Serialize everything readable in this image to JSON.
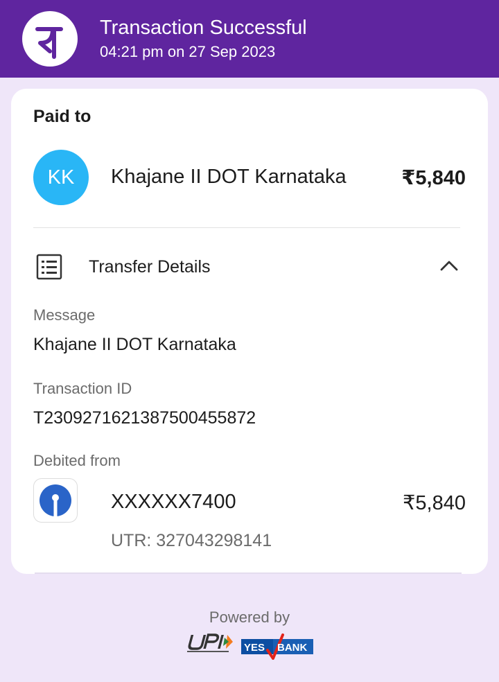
{
  "header": {
    "title": "Transaction Successful",
    "subtitle": "04:21 pm on 27 Sep 2023",
    "logo_icon": "phonepe-logo-icon",
    "bg_color": "#5f259f"
  },
  "payment": {
    "heading": "Paid to",
    "avatar_initials": "KK",
    "avatar_color": "#29b6f6",
    "payee_name": "Khajane II DOT Karnataka",
    "amount": "₹5,840"
  },
  "transfer_details": {
    "title": "Transfer Details",
    "icon": "receipt-list-icon",
    "toggle_icon": "chevron-up-icon",
    "message_label": "Message",
    "message_value": "Khajane II DOT Karnataka",
    "transaction_id_label": "Transaction ID",
    "transaction_id_value": "T2309271621387500455872",
    "debited_label": "Debited from",
    "bank_icon": "sbi-logo-icon",
    "account_number": "XXXXXX7400",
    "debit_amount": "₹5,840",
    "utr": "UTR: 327043298141"
  },
  "footer": {
    "powered_by": "Powered by",
    "upi_logo": "upi-logo-icon",
    "bank_logo": "yes-bank-logo-icon"
  }
}
